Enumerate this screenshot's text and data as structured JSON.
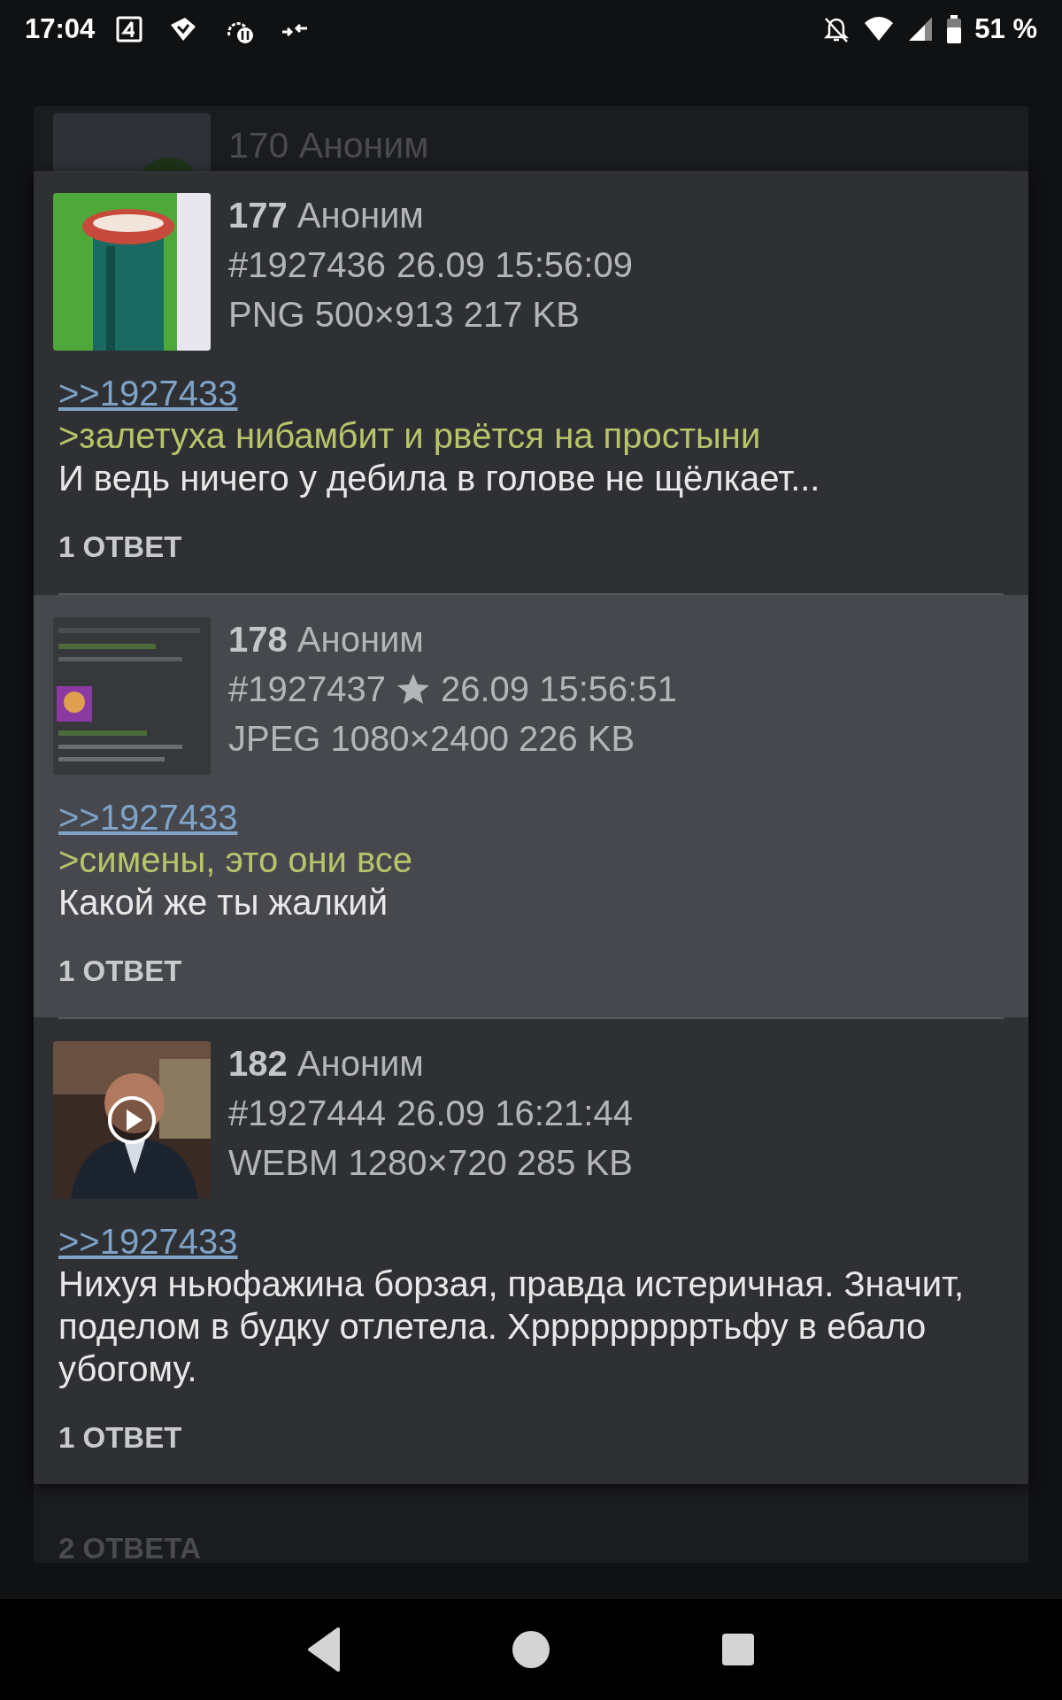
{
  "status_bar": {
    "time": "17:04",
    "battery": "51 %"
  },
  "background": {
    "top_post": {
      "number": "170",
      "name": "Аноним"
    },
    "bottom_replies": "2 ОТВЕТА"
  },
  "posts": [
    {
      "number": "177",
      "name": "Аноним",
      "post_no": "#1927436",
      "starred": false,
      "date": "26.09 15:56:09",
      "file": "PNG 500×913 217 KB",
      "video": false,
      "highlighted": false,
      "lines": [
        {
          "kind": "link",
          "text": ">>1927433"
        },
        {
          "kind": "quote",
          "text": ">залетуха нибамбит и рвётся на простыни"
        },
        {
          "kind": "text",
          "text": "И ведь ничего у дебила в голове не щёлкает..."
        }
      ],
      "replies": "1 ОТВЕТ"
    },
    {
      "number": "178",
      "name": "Аноним",
      "post_no": "#1927437",
      "starred": true,
      "date": "26.09 15:56:51",
      "file": "JPEG 1080×2400 226 KB",
      "video": false,
      "highlighted": true,
      "lines": [
        {
          "kind": "link",
          "text": ">>1927433"
        },
        {
          "kind": "quote",
          "text": ">симены, это они все"
        },
        {
          "kind": "text",
          "text": "Какой же ты жалкий"
        }
      ],
      "replies": "1 ОТВЕТ"
    },
    {
      "number": "182",
      "name": "Аноним",
      "post_no": "#1927444",
      "starred": false,
      "date": "26.09 16:21:44",
      "file": "WEBM 1280×720 285 KB",
      "video": true,
      "highlighted": false,
      "lines": [
        {
          "kind": "link",
          "text": ">>1927433"
        },
        {
          "kind": "text",
          "text": "Нихуя ньюфажина борзая, правда истеричная. Значит, поделом в будку отлетела. Хррррррррртьфу в ебало убогому."
        }
      ],
      "replies": "1 ОТВЕТ"
    }
  ]
}
